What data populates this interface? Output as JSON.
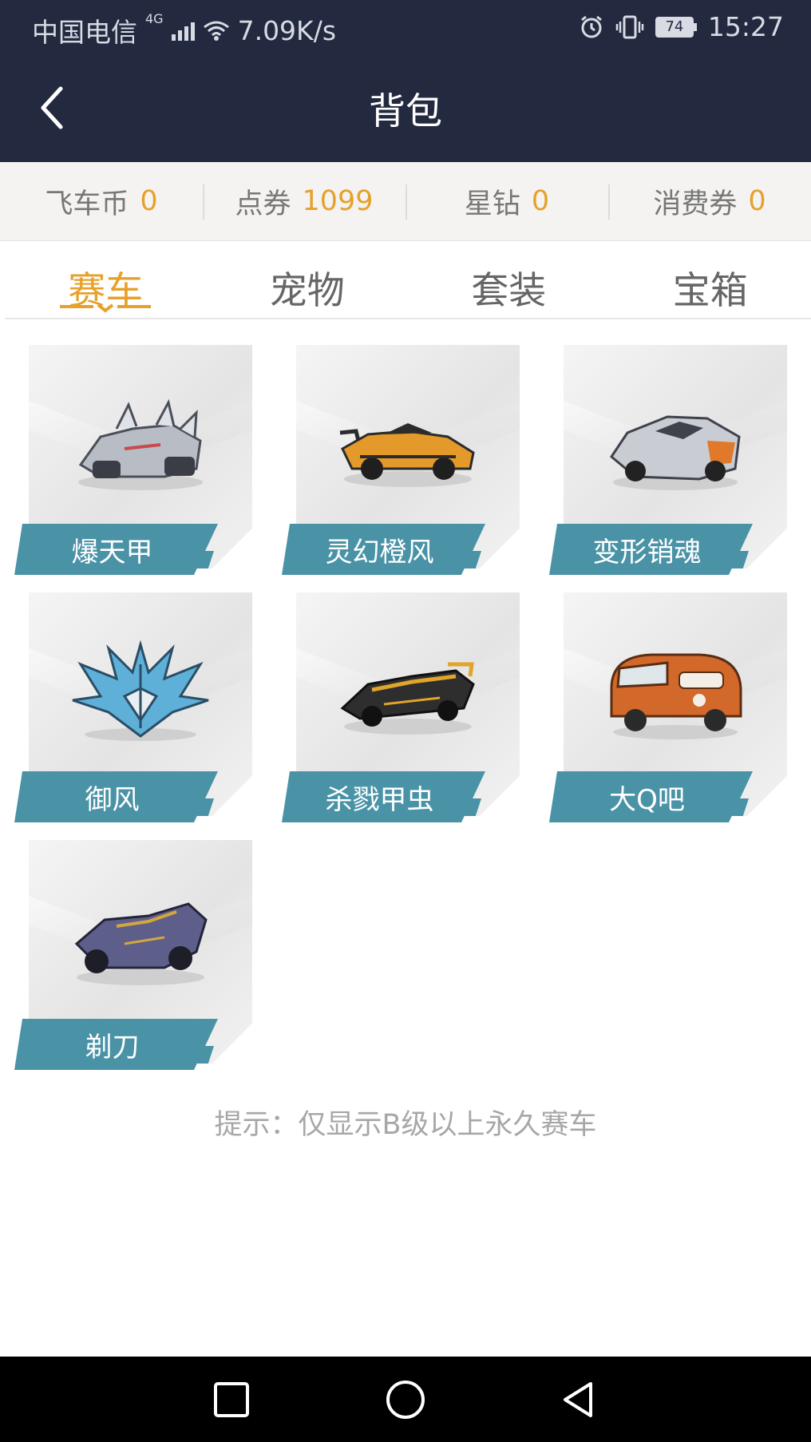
{
  "status_bar": {
    "carrier": "中国电信",
    "network": "4G",
    "speed": "7.09K/s",
    "battery": "74",
    "time": "15:27"
  },
  "header": {
    "title": "背包"
  },
  "currencies": [
    {
      "label": "飞车币",
      "value": "0"
    },
    {
      "label": "点券",
      "value": "1099"
    },
    {
      "label": "星钻",
      "value": "0"
    },
    {
      "label": "消费券",
      "value": "0"
    }
  ],
  "tabs": [
    {
      "label": "赛车",
      "active": true
    },
    {
      "label": "宠物",
      "active": false
    },
    {
      "label": "套装",
      "active": false
    },
    {
      "label": "宝箱",
      "active": false
    }
  ],
  "items": [
    {
      "name": "爆天甲",
      "icon": "armored-kart-icon",
      "color": "#b8bcc4"
    },
    {
      "name": "灵幻橙风",
      "icon": "orange-supercar-icon",
      "color": "#e39a2a"
    },
    {
      "name": "变形销魂",
      "icon": "silver-sportscar-icon",
      "color": "#c9ccd2"
    },
    {
      "name": "御风",
      "icon": "blue-winged-kart-icon",
      "color": "#5fb0d8"
    },
    {
      "name": "杀戮甲虫",
      "icon": "black-gold-supercar-icon",
      "color": "#2e2e2e"
    },
    {
      "name": "大Q吧",
      "icon": "orange-van-icon",
      "color": "#d2682a"
    },
    {
      "name": "剃刀",
      "icon": "purple-formula-kart-icon",
      "color": "#5d5f8a"
    }
  ],
  "hint": "提示：仅显示B级以上永久赛车",
  "colors": {
    "header_bg": "#232a3f",
    "accent": "#e6a12b",
    "label_bg": "#4a93a7"
  }
}
